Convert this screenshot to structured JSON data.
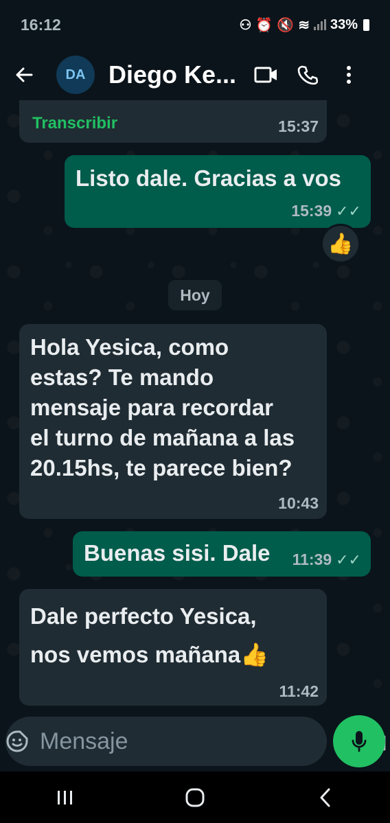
{
  "status_bar": {
    "time": "16:12",
    "battery": "33%"
  },
  "header": {
    "avatar_initials": "DA",
    "contact_name": "Diego Ke..."
  },
  "messages": [
    {
      "type": "incoming-voice",
      "action": "Transcribir",
      "time": "15:37"
    },
    {
      "type": "outgoing",
      "lines": [
        "Listo dale. Gracias a vos"
      ],
      "time": "15:39",
      "reaction": "👍"
    },
    {
      "type": "date",
      "text": "Hoy"
    },
    {
      "type": "incoming",
      "lines": [
        "Hola Yesica, como",
        "estas? Te mando",
        "mensaje para recordar",
        "el turno de mañana a las",
        "20.15hs, te parece bien?"
      ],
      "time": "10:43"
    },
    {
      "type": "outgoing",
      "lines": [
        "Buenas sisi. Dale"
      ],
      "time": "11:39"
    },
    {
      "type": "incoming",
      "lines": [
        "Dale perfecto Yesica,",
        "nos vemos mañana👍"
      ],
      "time": "11:42"
    }
  ],
  "composer": {
    "placeholder": "Mensaje"
  },
  "colors": {
    "background": "#0b141a",
    "incoming_bubble": "#202c33",
    "outgoing_bubble": "#005c4b",
    "accent": "#21c063"
  }
}
